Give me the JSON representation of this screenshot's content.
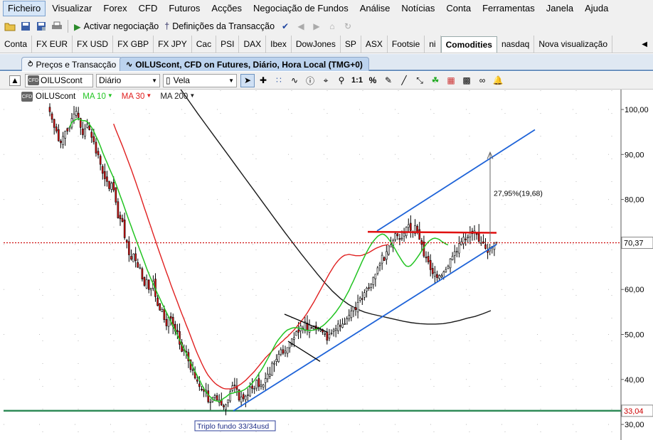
{
  "menu": [
    "Ficheiro",
    "Visualizar",
    "Forex",
    "CFD",
    "Futuros",
    "Acções",
    "Negociação de Fundos",
    "Análise",
    "Notícias",
    "Conta",
    "Ferramentas",
    "Janela",
    "Ajuda"
  ],
  "toolbar": {
    "activate_trading": "Activar negociação",
    "trade_settings": "Definições da Transacção"
  },
  "quick_tabs": [
    "Conta",
    "FX EUR",
    "FX USD",
    "FX GBP",
    "FX JPY",
    "Cac",
    "PSI",
    "DAX",
    "Ibex",
    "DowJones",
    "SP",
    "ASX",
    "Footsie",
    "ni",
    "Comodities",
    "nasdaq",
    "Nova visualização"
  ],
  "active_quick_tab": "Comodities",
  "doc_tabs": {
    "prices": "Preços e Transacção",
    "chart": "OILUScont, CFD on Futures, Diário, Hora Local (TMG+0)"
  },
  "chart_toolbar": {
    "instrument": "OILUScont",
    "badge": "CFD",
    "period": "Diário",
    "chart_type": "Vela",
    "scale_label": "1:1",
    "percent_label": "%"
  },
  "legend": {
    "instrument": "OILUScont",
    "ma10": "MA 10",
    "ma30": "MA 30",
    "ma200": "MA 200"
  },
  "colors": {
    "ma10": "#22c422",
    "ma30": "#e02020",
    "ma200": "#1a1a1a",
    "up_candle": "#ffffff",
    "down_candle": "#e01010",
    "trendline": "#1e63d8",
    "resistance": "#e01010",
    "support": "#2e8b57",
    "last_price": "#cc0000"
  },
  "chart_data": {
    "type": "candlestick",
    "y_ticks": [
      "100,00",
      "90,00",
      "80,00",
      "70,00",
      "60,00",
      "50,00",
      "40,00",
      "30,00"
    ],
    "ylim": [
      28,
      106
    ],
    "last_price_label": "70,37",
    "support_label": "33,04",
    "last_price": 70.37,
    "support_price": 33.04,
    "measurement_label": "27,95%(19,68)",
    "annotation": "Triplo fundo 33/34usd",
    "closes": [
      99.5,
      97.8,
      96.0,
      95.2,
      93.0,
      92.6,
      94.0,
      95.2,
      95.2,
      96.0,
      98.0,
      99.0,
      99.6,
      98.2,
      96.0,
      94.4,
      95.7,
      96.7,
      95.5,
      93.8,
      92.8,
      90.3,
      89.9,
      87.8,
      85.8,
      84.6,
      84.0,
      82.4,
      83.6,
      82.1,
      79.4,
      75.9,
      75.7,
      75.1,
      71.5,
      70.4,
      67.7,
      66.7,
      67.9,
      66.4,
      64.9,
      64.8,
      62.3,
      60.9,
      62.2,
      60.0,
      60.3,
      61.8,
      58.4,
      56.4,
      55.4,
      55.5,
      53.3,
      51.9,
      53.8,
      53.6,
      51.8,
      50.7,
      50.6,
      47.8,
      46.2,
      46.4,
      46.0,
      44.1,
      42.2,
      42.1,
      40.3,
      39.6,
      38.4,
      37.7,
      37.4,
      37.6,
      35.0,
      35.0,
      36.0,
      36.4,
      35.4,
      35.4,
      34.3,
      33.9,
      34.4,
      35.5,
      37.3,
      38.6,
      38.7,
      37.8,
      35.4,
      36.1,
      35.7,
      36.3,
      36.6,
      38.3,
      38.0,
      38.0,
      39.8,
      38.4,
      38.8,
      38.8,
      40.2,
      41.2,
      41.2,
      43.6,
      43.6,
      44.5,
      45.6,
      46.6,
      45.8,
      46.3,
      47.1,
      48.3,
      49.0,
      49.3,
      50.6,
      50.5,
      51.9,
      51.4,
      52.8,
      50.9,
      52.1,
      51.5,
      51.9,
      51.0,
      51.3,
      51.3,
      50.5,
      50.2,
      48.7,
      50.0,
      50.3,
      51.0,
      51.3,
      52.3,
      51.9,
      52.3,
      52.4,
      53.5,
      54.3,
      55.2,
      56.1,
      55.5,
      57.1,
      58.1,
      57.8,
      59.3,
      60.3,
      60.3,
      61.2,
      62.7,
      63.4,
      64.8,
      65.7,
      67.6,
      66.4,
      68.4,
      69.7,
      69.9,
      70.9,
      72.4,
      71.9,
      71.1,
      71.4,
      72.5,
      73.8,
      74.4,
      73.1,
      72.7,
      74.2,
      72.8,
      71.1,
      70.0,
      67.4,
      67.0,
      66.1,
      64.4,
      63.5,
      63.8,
      62.6,
      63.1,
      63.1,
      63.9,
      64.4,
      65.2,
      66.8,
      67.4,
      68.4,
      68.5,
      70.2,
      70.6,
      71.6,
      71.0,
      71.6,
      72.7,
      72.4,
      73.0,
      72.2,
      70.7,
      70.4,
      70.3,
      69.1,
      68.2,
      69.3,
      69.3,
      70.3,
      70.4
    ],
    "ma10_start_index": 9,
    "ma10": [
      96.0,
      97.2,
      97.5,
      97.8,
      98.0,
      97.7,
      97.5,
      97.5,
      97.3,
      96.7,
      96.0,
      95.1,
      94.0,
      93.0,
      91.8,
      90.5,
      89.3,
      88.2,
      87.0,
      85.9,
      84.8,
      83.5,
      82.2,
      80.8,
      79.5,
      78.1,
      76.7,
      75.3,
      74.0,
      72.6,
      71.3,
      70.0,
      68.7,
      67.4,
      66.1,
      64.7,
      63.5,
      62.3,
      61.2,
      60.1,
      59.0,
      58.0,
      56.9,
      55.9,
      54.9,
      53.9,
      52.9,
      51.9,
      50.9,
      49.8,
      48.8,
      47.8,
      46.8,
      45.8,
      44.8,
      43.8,
      42.8,
      41.8,
      40.8,
      39.9,
      38.9,
      38.0,
      37.2,
      36.6,
      36.1,
      35.6,
      35.3,
      35.2,
      35.1,
      35.4,
      35.8,
      36.1,
      36.5,
      36.9,
      36.9,
      37.1,
      37.2,
      37.3,
      37.4,
      37.6,
      37.9,
      38.3,
      38.7,
      39.2,
      39.8,
      40.5,
      41.3,
      42.0,
      42.8,
      43.7,
      44.6,
      45.5,
      46.4,
      47.3,
      48.2,
      48.9,
      49.5,
      50.1,
      50.6,
      51.0,
      51.2,
      51.4,
      51.5,
      51.5,
      51.4,
      51.3,
      51.2,
      51.0,
      50.9,
      50.9,
      50.9,
      51.0,
      51.1,
      51.3,
      51.6,
      51.9,
      52.3,
      52.8,
      53.3,
      53.8,
      54.4,
      55.0,
      55.7,
      56.4,
      57.2,
      58.0,
      58.9,
      59.8,
      60.9,
      61.9,
      63.0,
      64.1,
      65.2,
      66.3,
      67.3,
      68.3,
      69.2,
      70.0,
      70.7,
      71.3,
      71.8,
      72.1,
      72.3,
      72.2,
      71.8,
      71.2,
      70.5,
      69.7,
      68.9,
      68.0,
      67.2,
      66.4,
      65.7,
      65.2,
      65.1,
      65.3,
      65.8,
      66.4,
      67.1,
      67.8,
      68.6,
      69.3,
      70.0,
      70.6,
      71.0,
      71.3,
      71.4,
      71.3,
      71.1,
      70.7,
      70.4,
      70.1,
      69.9
    ],
    "ma30_start_index": 29,
    "ma30": [
      96.8,
      95.5,
      94.3,
      93.1,
      91.9,
      90.6,
      89.3,
      88.0,
      86.7,
      85.3,
      83.9,
      82.5,
      81.1,
      79.6,
      78.1,
      76.7,
      75.2,
      73.8,
      72.3,
      70.9,
      69.4,
      68.0,
      66.6,
      65.2,
      63.8,
      62.5,
      61.1,
      59.8,
      58.5,
      57.2,
      55.9,
      54.6,
      53.4,
      52.1,
      50.9,
      49.6,
      48.3,
      47.0,
      45.8,
      44.7,
      43.6,
      42.6,
      41.7,
      40.9,
      40.3,
      39.7,
      39.2,
      38.8,
      38.5,
      38.2,
      38.0,
      37.9,
      37.9,
      37.9,
      38.0,
      38.2,
      38.4,
      38.7,
      39.0,
      39.4,
      39.8,
      40.3,
      40.8,
      41.3,
      41.8,
      42.4,
      43.0,
      43.6,
      44.2,
      44.8,
      45.3,
      45.8,
      46.3,
      46.8,
      47.3,
      47.7,
      48.2,
      48.6,
      49.1,
      49.5,
      50.0,
      50.5,
      51.0,
      51.6,
      52.2,
      52.8,
      53.4,
      54.1,
      54.8,
      55.6,
      56.4,
      57.2,
      58.1,
      59.0,
      59.9,
      60.8,
      61.7,
      62.6,
      63.5,
      64.3,
      65.1,
      65.8,
      66.4,
      66.9,
      67.3,
      67.6,
      67.7,
      67.8,
      67.7,
      67.6,
      67.5,
      67.5,
      67.5,
      67.6,
      67.8,
      68.0,
      68.2,
      68.5,
      68.8,
      69.1,
      69.3,
      69.5,
      69.7,
      69.8,
      69.9,
      70.0
    ],
    "ma200": [
      106.5,
      104.0,
      101.5,
      99.0,
      96.6,
      94.2,
      91.8,
      89.4,
      87.0,
      84.6,
      82.2,
      79.8,
      77.4,
      75.0,
      72.6,
      70.3,
      68.0,
      65.8,
      63.6,
      61.5,
      59.6,
      58.0,
      56.7,
      55.7,
      55.0,
      54.5,
      54.1,
      53.7,
      53.3,
      52.9,
      52.6,
      52.4,
      52.3,
      52.3,
      52.4,
      52.7,
      53.1,
      53.6,
      54.0,
      54.6,
      55.3
    ],
    "ma200_start_index": 42
  }
}
